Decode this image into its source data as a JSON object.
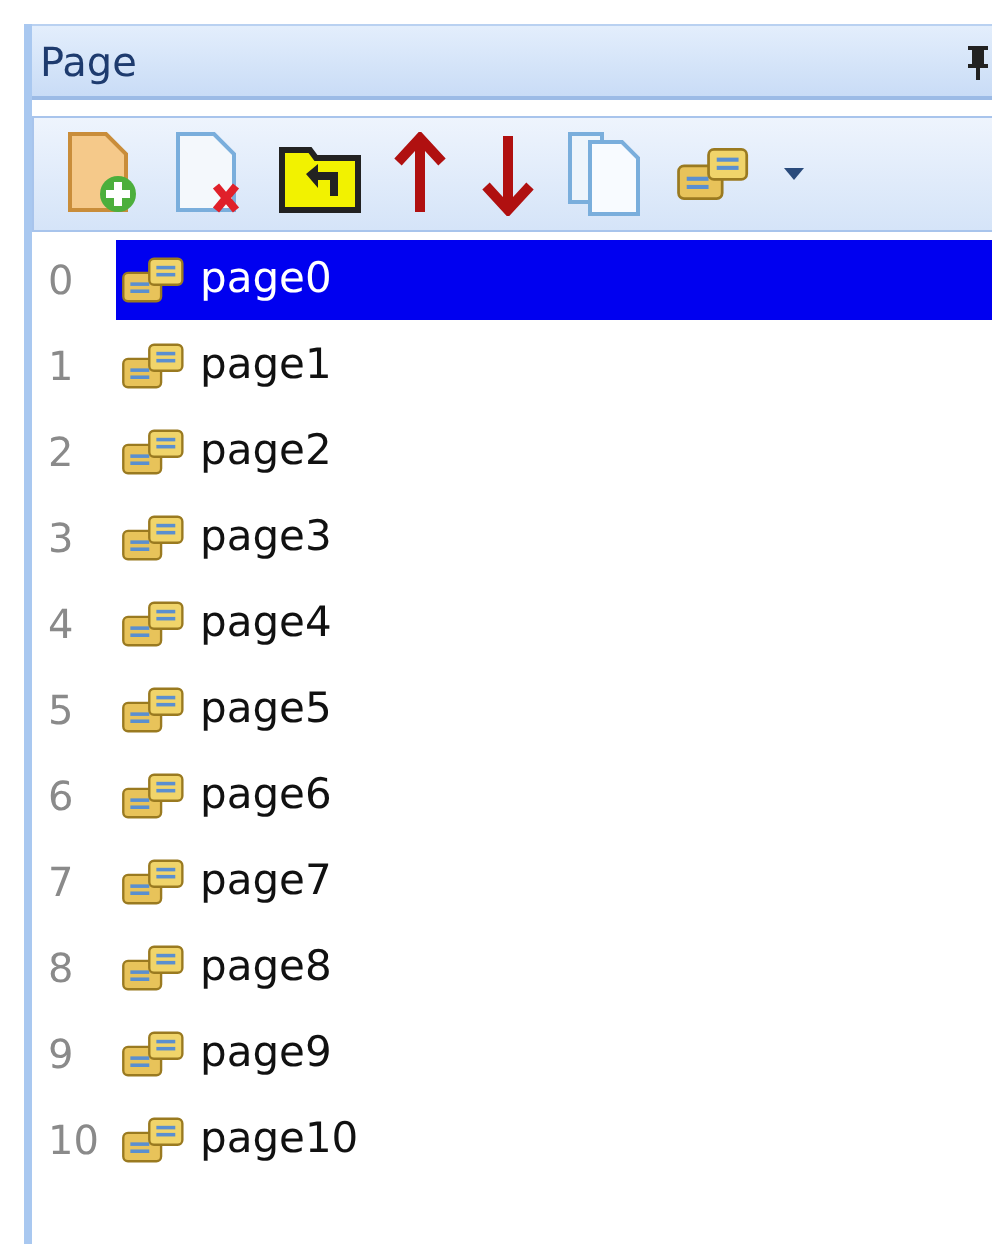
{
  "panel": {
    "title": "Page"
  },
  "pages": [
    {
      "index": "0",
      "name": "page0",
      "selected": true
    },
    {
      "index": "1",
      "name": "page1",
      "selected": false
    },
    {
      "index": "2",
      "name": "page2",
      "selected": false
    },
    {
      "index": "3",
      "name": "page3",
      "selected": false
    },
    {
      "index": "4",
      "name": "page4",
      "selected": false
    },
    {
      "index": "5",
      "name": "page5",
      "selected": false
    },
    {
      "index": "6",
      "name": "page6",
      "selected": false
    },
    {
      "index": "7",
      "name": "page7",
      "selected": false
    },
    {
      "index": "8",
      "name": "page8",
      "selected": false
    },
    {
      "index": "9",
      "name": "page9",
      "selected": false
    },
    {
      "index": "10",
      "name": "page10",
      "selected": false
    }
  ]
}
